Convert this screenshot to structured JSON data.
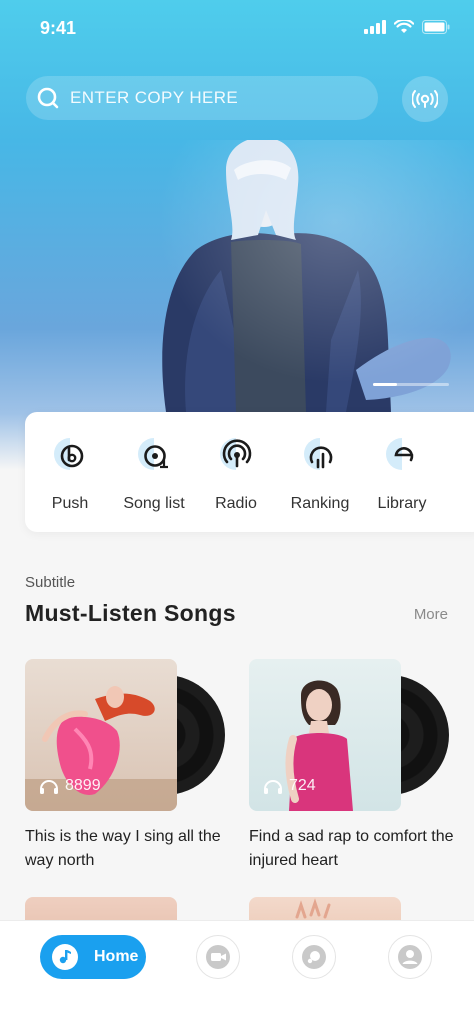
{
  "status_bar": {
    "time": "9:41"
  },
  "search": {
    "placeholder": "ENTER COPY HERE"
  },
  "categories": [
    {
      "label": "Push",
      "icon": "push-icon"
    },
    {
      "label": "Song list",
      "icon": "song-list-icon"
    },
    {
      "label": "Radio",
      "icon": "radio-icon"
    },
    {
      "label": "Ranking",
      "icon": "ranking-icon"
    },
    {
      "label": "Library",
      "icon": "library-icon"
    }
  ],
  "section": {
    "subtitle": "Subtitle",
    "title": "Must-Listen Songs",
    "more": "More"
  },
  "songs": [
    {
      "title": "This is the way I sing all the way north",
      "plays": "8899"
    },
    {
      "title": "Find a sad rap to comfort the injured heart",
      "plays": "724"
    }
  ],
  "nav": {
    "home_label": "Home"
  },
  "colors": {
    "accent": "#1aa0ef",
    "hero_top": "#4fcdec",
    "hero_mid": "#6aa6dc"
  }
}
